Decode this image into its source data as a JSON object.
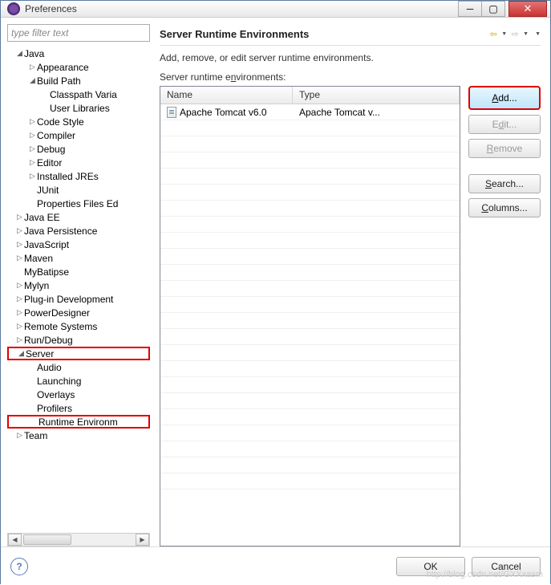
{
  "window": {
    "title": "Preferences"
  },
  "filter": {
    "placeholder": "type filter text"
  },
  "tree": {
    "java": "Java",
    "appearance": "Appearance",
    "build_path": "Build Path",
    "classpath_vars": "Classpath Varia",
    "user_libs": "User Libraries",
    "code_style": "Code Style",
    "compiler": "Compiler",
    "debug": "Debug",
    "editor": "Editor",
    "installed_jres": "Installed JREs",
    "junit": "JUnit",
    "prop_files": "Properties Files Ed",
    "java_ee": "Java EE",
    "java_persist": "Java Persistence",
    "javascript": "JavaScript",
    "maven": "Maven",
    "mybatipse": "MyBatipse",
    "mylyn": "Mylyn",
    "plugin_dev": "Plug-in Development",
    "power_designer": "PowerDesigner",
    "remote_sys": "Remote Systems",
    "run_debug": "Run/Debug",
    "server": "Server",
    "audio": "Audio",
    "launching": "Launching",
    "overlays": "Overlays",
    "profilers": "Profilers",
    "runtime_env": "Runtime Environm",
    "team": "Team"
  },
  "page": {
    "title": "Server Runtime Environments",
    "desc": "Add, remove, or edit server runtime environments.",
    "table_label_pre": "Server runtime e",
    "table_label_mn": "n",
    "table_label_post": "vironments:"
  },
  "table": {
    "col_name": "Name",
    "col_type": "Type",
    "rows": [
      {
        "name": "Apache Tomcat v6.0",
        "type": "Apache Tomcat v..."
      }
    ]
  },
  "buttons": {
    "add_mn": "A",
    "add_rest": "dd...",
    "edit_pre": "E",
    "edit_mn": "d",
    "edit_post": "it...",
    "remove_mn": "R",
    "remove_rest": "emove",
    "search_mn": "S",
    "search_rest": "earch...",
    "columns_mn": "C",
    "columns_rest": "olumns...",
    "ok": "OK",
    "cancel": "Cancel"
  },
  "watermark": "http://blog.csdn.net/GXXxasm"
}
